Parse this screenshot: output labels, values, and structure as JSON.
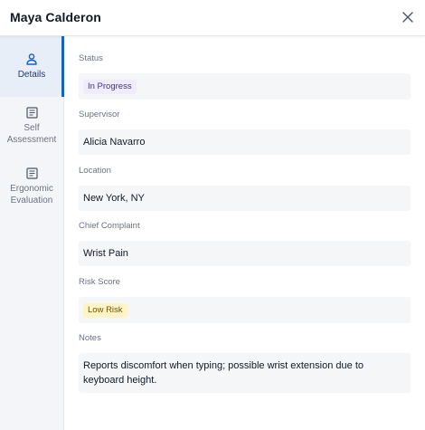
{
  "header": {
    "title": "Maya Calderon"
  },
  "nav": {
    "items": [
      {
        "label": "Details",
        "icon": "person-icon",
        "active": true
      },
      {
        "label": "Self Assessment",
        "icon": "document-icon",
        "active": false
      },
      {
        "label": "Ergonomic Evaluation",
        "icon": "document-icon",
        "active": false
      }
    ]
  },
  "fields": {
    "status": {
      "label": "Status",
      "value": "In Progress"
    },
    "supervisor": {
      "label": "Supervisor",
      "value": "Alicia Navarro"
    },
    "location": {
      "label": "Location",
      "value": "New York, NY"
    },
    "chief_complaint": {
      "label": "Chief Complaint",
      "value": "Wrist Pain"
    },
    "risk_score": {
      "label": "Risk Score",
      "value": "Low Risk"
    },
    "notes": {
      "label": "Notes",
      "value": "Reports discomfort when typing; possible wrist extension due to keyboard height."
    }
  },
  "colors": {
    "accent": "#1565c0",
    "status_pill_bg": "#f1ecfb",
    "risk_pill_bg": "#fff4c6"
  }
}
